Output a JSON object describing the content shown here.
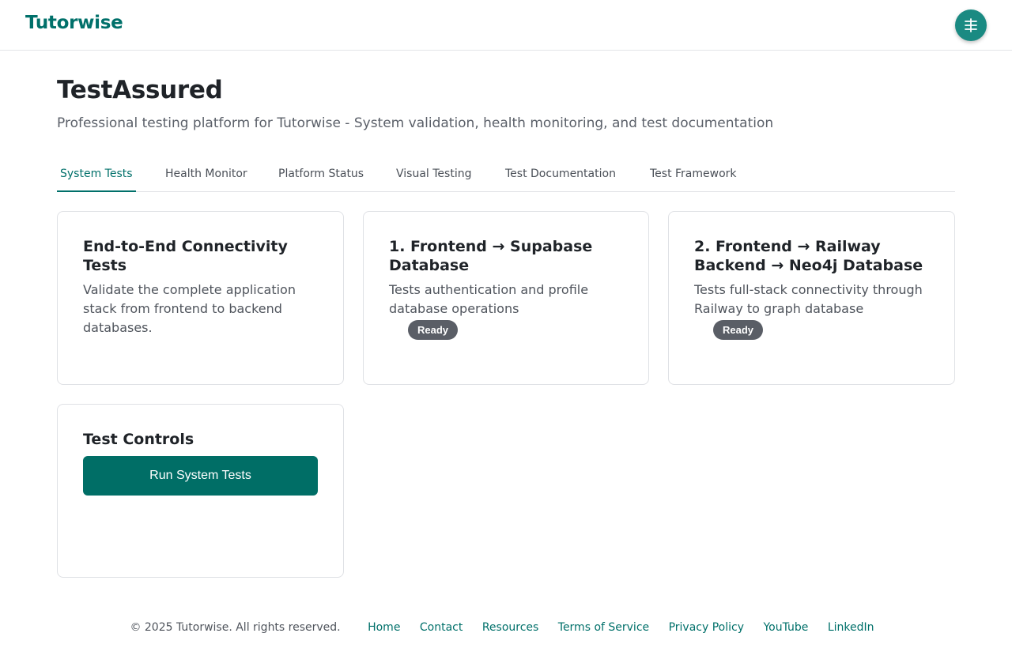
{
  "header": {
    "logo": "Tutorwise",
    "menu_icon": "menu-icon"
  },
  "page": {
    "title": "TestAssured",
    "subtitle": "Professional testing platform for Tutorwise - System validation, health monitoring, and test documentation"
  },
  "tabs": [
    {
      "label": "System Tests",
      "active": true
    },
    {
      "label": "Health Monitor",
      "active": false
    },
    {
      "label": "Platform Status",
      "active": false
    },
    {
      "label": "Visual Testing",
      "active": false
    },
    {
      "label": "Test Documentation",
      "active": false
    },
    {
      "label": "Test Framework",
      "active": false
    }
  ],
  "cards": [
    {
      "title": "End-to-End Connectivity Tests",
      "description": "Validate the complete application stack from frontend to backend databases."
    },
    {
      "title": "1. Frontend → Supabase Database",
      "description": "Tests authentication and profile database operations",
      "status": "Ready"
    },
    {
      "title": "2. Frontend → Railway Backend → Neo4j Database",
      "description": "Tests full-stack connectivity through Railway to graph database",
      "status": "Ready"
    }
  ],
  "controls": {
    "title": "Test Controls",
    "run_button": "Run System Tests"
  },
  "footer": {
    "copyright": "© 2025 Tutorwise. All rights reserved.",
    "links": [
      "Home",
      "Contact",
      "Resources",
      "Terms of Service",
      "Privacy Policy",
      "YouTube",
      "LinkedIn"
    ]
  },
  "colors": {
    "accent": "#00706a",
    "badge": "#5a5e66",
    "button": "#006e66"
  }
}
